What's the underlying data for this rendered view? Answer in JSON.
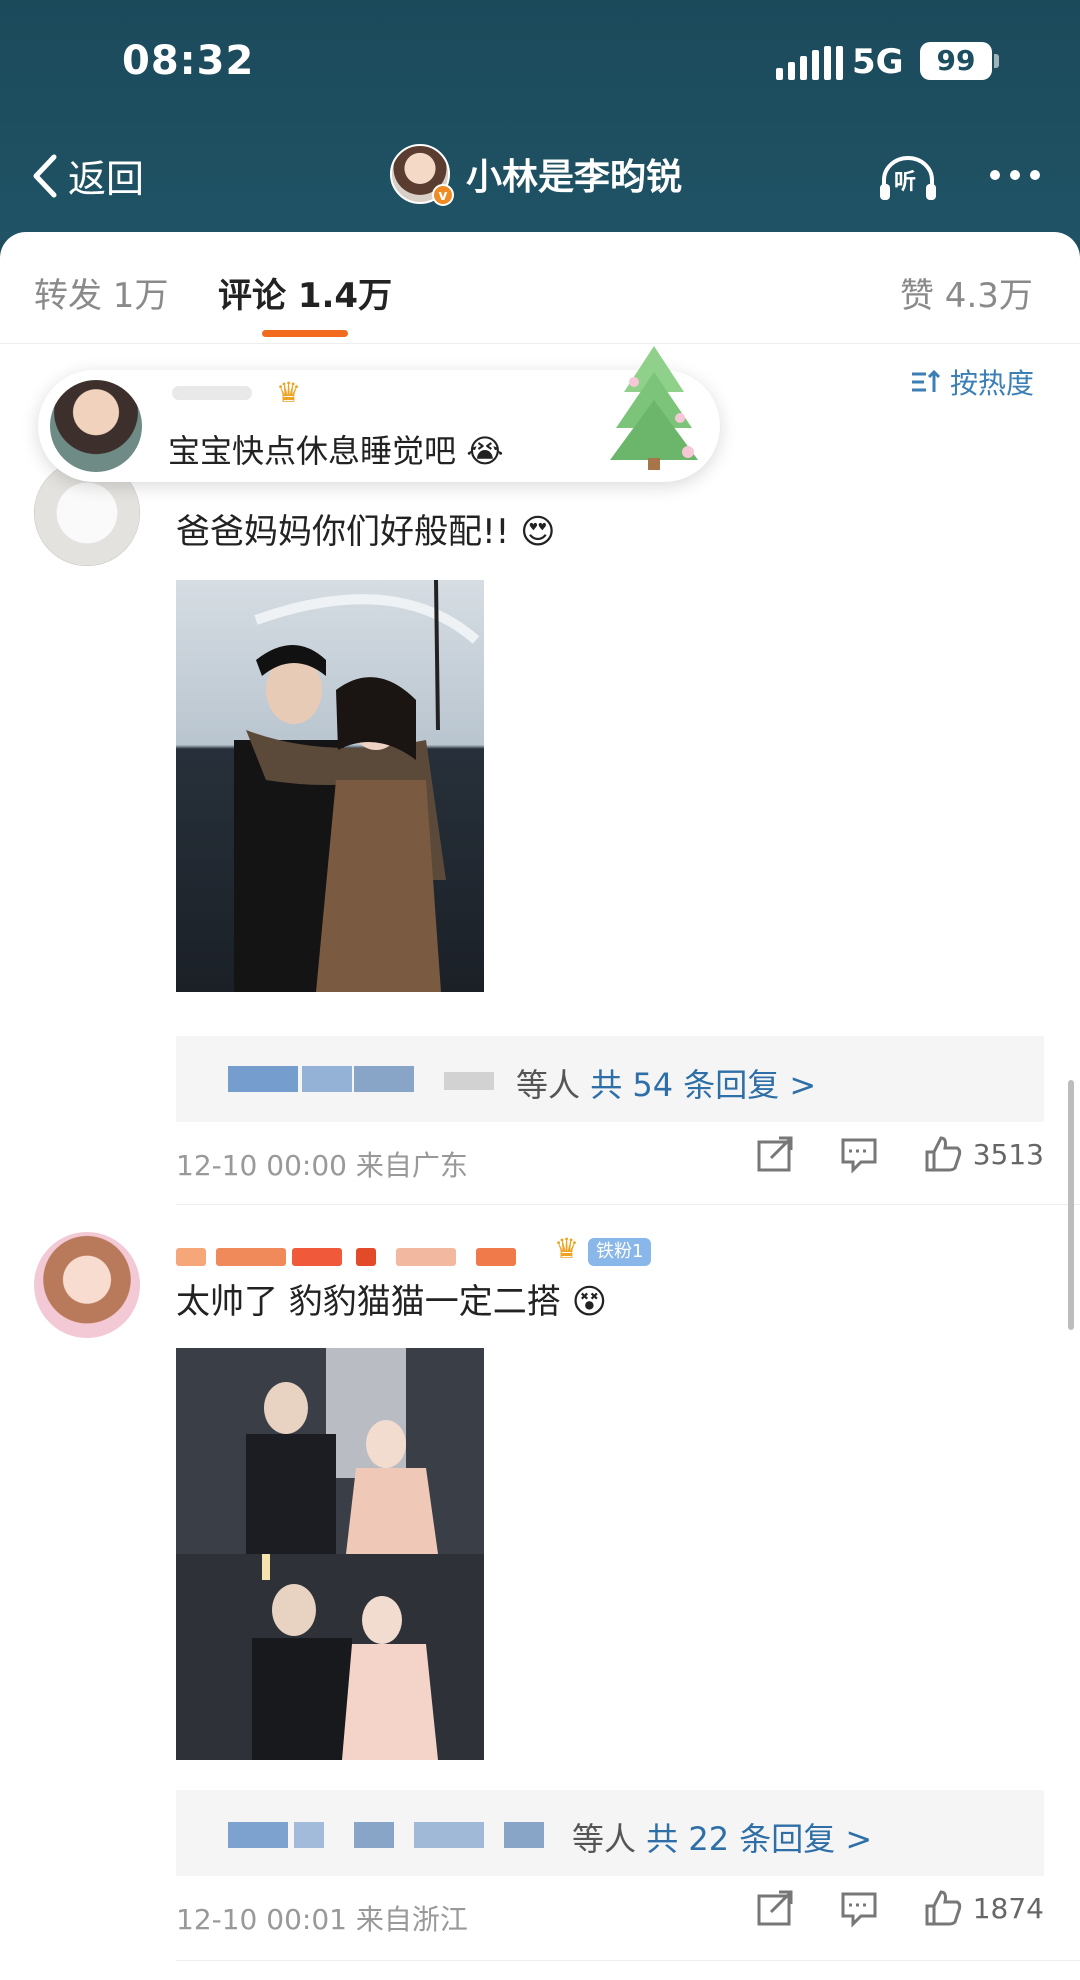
{
  "status_bar": {
    "time": "08:32",
    "network": "5G",
    "battery": "99"
  },
  "header": {
    "back_label": "返回",
    "title": "小林是李昀锐",
    "listen_label": "听"
  },
  "tabs": [
    {
      "label": "转发 1万"
    },
    {
      "label": "评论 1.4万"
    },
    {
      "label": "赞 4.3万"
    }
  ],
  "sort_label": "按热度",
  "floating_comment": {
    "text": "宝宝快点休息睡觉吧"
  },
  "comments": [
    {
      "text": "爸爸妈妈你们好般配!!",
      "reply_summary_prefix": "等人",
      "reply_summary_link": "共 54 条回复 >",
      "time": "12-10 00:00",
      "location": "来自广东",
      "likes": "3513"
    },
    {
      "text": "太帅了 豹豹猫猫一定二搭",
      "fan_badge": "铁粉1",
      "reply_summary_prefix": "等人",
      "reply_summary_link": "共 22 条回复 >",
      "time": "12-10 00:01",
      "location": "来自浙江",
      "likes": "1874"
    }
  ],
  "colors": {
    "header_bg": "#1f4d5e",
    "accent": "#f26a1d",
    "link": "#2f6fa8"
  }
}
